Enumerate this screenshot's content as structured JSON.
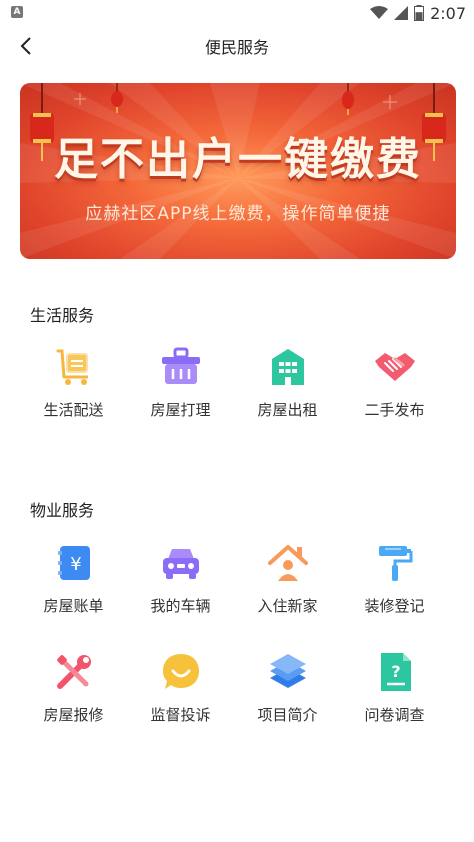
{
  "status": {
    "indicator": "A",
    "time": "2:07",
    "battery_level": 0.6
  },
  "header": {
    "title": "便民服务"
  },
  "banner": {
    "title": "足不出户一键缴费",
    "subtitle": "应赫社区APP线上缴费，操作简单便捷"
  },
  "sections": [
    {
      "title": "生活服务",
      "items": [
        {
          "label": "生活配送",
          "icon": "delivery-cart-icon",
          "color": "#f6b73c"
        },
        {
          "label": "房屋打理",
          "icon": "basket-icon",
          "color": "#8b6cf6"
        },
        {
          "label": "房屋出租",
          "icon": "building-icon",
          "color": "#2cc6a0"
        },
        {
          "label": "二手发布",
          "icon": "handshake-icon",
          "color": "#f25c6e"
        }
      ]
    },
    {
      "title": "物业服务",
      "items": [
        {
          "label": "房屋账单",
          "icon": "yuan-bill-icon",
          "color": "#3d8bf2"
        },
        {
          "label": "我的车辆",
          "icon": "car-icon",
          "color": "#8b6cf6"
        },
        {
          "label": "入住新家",
          "icon": "house-person-icon",
          "color": "#f79a5a"
        },
        {
          "label": "装修登记",
          "icon": "paint-roller-icon",
          "color": "#4aa8f5"
        },
        {
          "label": "房屋报修",
          "icon": "repair-tools-icon",
          "color": "#f2556b"
        },
        {
          "label": "监督投诉",
          "icon": "smile-chat-icon",
          "color": "#f6c23c"
        },
        {
          "label": "项目简介",
          "icon": "layers-icon",
          "color": "#3d8bf2"
        },
        {
          "label": "问卷调查",
          "icon": "questionnaire-icon",
          "color": "#2cc6a0"
        }
      ]
    }
  ]
}
